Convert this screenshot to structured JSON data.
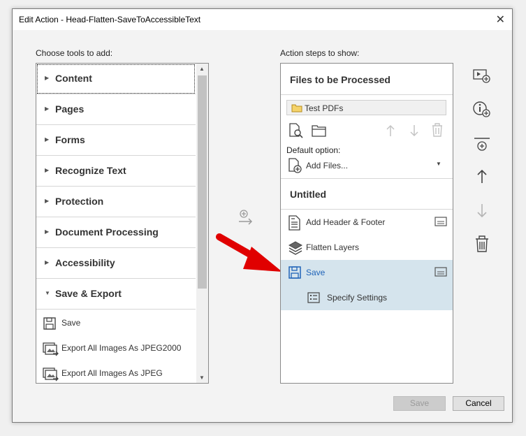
{
  "window": {
    "title": "Edit Action - Head-Flatten-SaveToAccessibleText"
  },
  "left": {
    "heading": "Choose tools to add:",
    "categories": [
      {
        "label": "Content"
      },
      {
        "label": "Pages"
      },
      {
        "label": "Forms"
      },
      {
        "label": "Recognize Text"
      },
      {
        "label": "Protection"
      },
      {
        "label": "Document Processing"
      },
      {
        "label": "Accessibility"
      },
      {
        "label": "Save & Export"
      }
    ],
    "tools": [
      {
        "label": "Save"
      },
      {
        "label": "Export All Images As JPEG2000"
      },
      {
        "label": "Export All Images As JPEG"
      }
    ]
  },
  "right": {
    "heading": "Action steps to show:",
    "files_header": "Files to be Processed",
    "folder": "Test PDFs",
    "default_option_label": "Default option:",
    "default_option_value": "Add Files...",
    "group_title": "Untitled",
    "steps": [
      {
        "label": "Add Header & Footer"
      },
      {
        "label": "Flatten Layers"
      },
      {
        "label": "Save"
      },
      {
        "label": "Specify Settings"
      }
    ]
  },
  "buttons": {
    "save": "Save",
    "cancel": "Cancel"
  },
  "colors": {
    "selected_row": "#d5e4ed",
    "accent": "#1f63b8",
    "arrow": "#e00000"
  }
}
